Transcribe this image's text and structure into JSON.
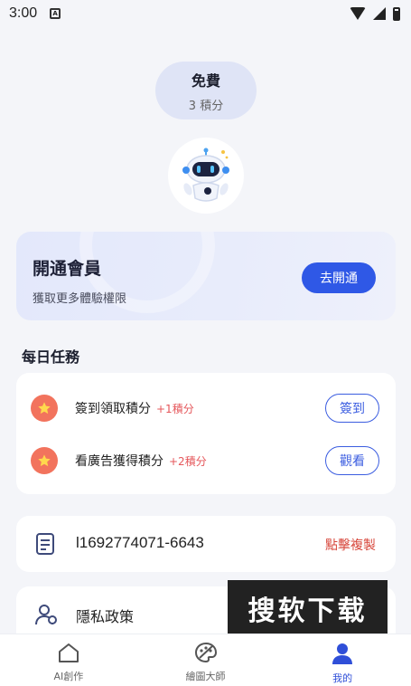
{
  "status_bar": {
    "time": "3:00",
    "notification_badge": "A"
  },
  "plan": {
    "name": "免費",
    "points": "3 積分"
  },
  "vip": {
    "title": "開通會員",
    "subtitle": "獲取更多體驗權限",
    "button": "去開通"
  },
  "daily_tasks": {
    "title": "每日任務",
    "items": [
      {
        "label": "簽到領取積分",
        "reward": "+1積分",
        "button": "簽到"
      },
      {
        "label": "看廣告獲得積分",
        "reward": "+2積分",
        "button": "觀看"
      }
    ]
  },
  "account": {
    "user_id": "l1692774071-6643",
    "copy_label": "點擊複製"
  },
  "privacy": {
    "label": "隱私政策"
  },
  "watermark": "搜软下载",
  "tabs": [
    {
      "label": "AI創作",
      "icon": "home-icon",
      "active": false
    },
    {
      "label": "繪圖大師",
      "icon": "palette-icon",
      "active": false
    },
    {
      "label": "我的",
      "icon": "user-icon",
      "active": true
    }
  ],
  "colors": {
    "accent": "#2f58e6",
    "reward": "#e5575b",
    "star_badge": "#f2735d",
    "background": "#f4f5f9"
  }
}
